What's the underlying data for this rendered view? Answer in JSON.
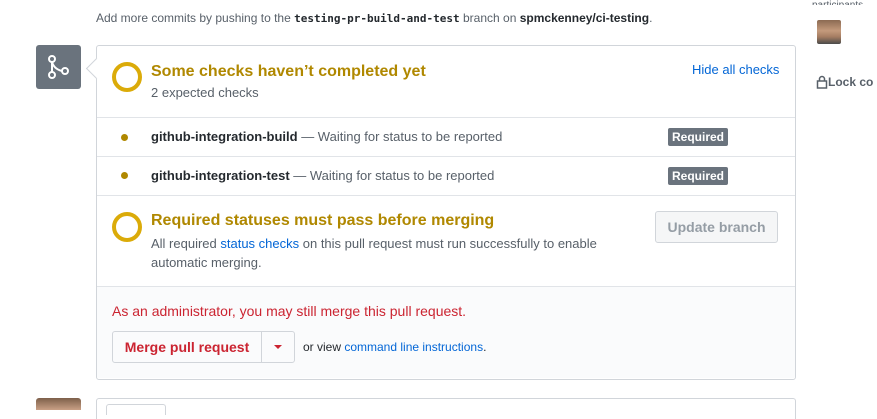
{
  "note": {
    "prefix": "Add more commits by pushing to the ",
    "branch": "testing-pr-build-and-test",
    "middle": " branch on ",
    "repo": "spmckenney/ci-testing",
    "suffix": "."
  },
  "checks_header": {
    "title": "Some checks haven’t completed yet",
    "subtitle": "2 expected checks",
    "toggle_link": "Hide all checks"
  },
  "checks": [
    {
      "name": "github-integration-build",
      "description": " — Waiting for status to be reported",
      "badge": "Required"
    },
    {
      "name": "github-integration-test",
      "description": " — Waiting for status to be reported",
      "badge": "Required"
    }
  ],
  "required_statuses": {
    "title": "Required statuses must pass before merging",
    "desc_before": "All required ",
    "desc_link": "status checks",
    "desc_after": " on this pull request must run successfully to enable automatic merging.",
    "update_button": "Update branch"
  },
  "merge": {
    "admin_note": "As an administrator, you may still merge this pull request.",
    "merge_button": "Merge pull request",
    "or_view_prefix": "or view ",
    "cli_link": "command line instructions",
    "or_view_suffix": "."
  },
  "sidebar": {
    "participants_label": "participants",
    "lock_label": "Lock co"
  },
  "colors": {
    "pending": "#dbab09",
    "pending_text": "#b08800",
    "danger": "#cb2431",
    "link": "#0366d6",
    "badge": "#6a737d"
  },
  "icons": [
    "merge-icon",
    "pending-ring-icon",
    "status-dot-icon",
    "caret-down-icon",
    "lock-icon",
    "avatar"
  ]
}
